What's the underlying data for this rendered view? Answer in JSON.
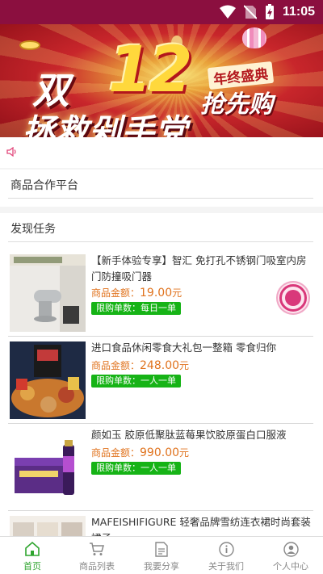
{
  "status_bar": {
    "time": "11:05"
  },
  "banner": {
    "number": "12",
    "shuang": "双",
    "tag": "年终盛典",
    "qiang": "抢先购",
    "main": "拯救剁手党"
  },
  "sections": {
    "platform": "商品合作平台",
    "tasks": "发现任务"
  },
  "products": [
    {
      "title": "【新手体验专享】智汇 免打孔不锈钢门吸室内房门防撞吸门器",
      "price_label": "商品金额：",
      "price": "19.00",
      "unit": "元",
      "limit": "限购单数：每日一单",
      "image": "door-stopper-image"
    },
    {
      "title": "进口食品休闲零食大礼包一整箱 零食归你",
      "price_label": "商品金额：",
      "price": "248.00",
      "unit": "元",
      "limit": "限购单数：一人一单",
      "image": "snack-gift-box-image"
    },
    {
      "title": "颜如玉 胶原低聚肽蓝莓果饮胶原蛋白口服液",
      "price_label": "商品金额：",
      "price": "990.00",
      "unit": "元",
      "limit": "限购单数：一人一单",
      "image": "collagen-drink-image"
    },
    {
      "title": "MAFEISHIFIGURE 轻奢品牌雪纺连衣裙时尚套装裙子",
      "image": "dress-image"
    }
  ],
  "tabs": [
    {
      "label": "首页",
      "icon": "home-icon",
      "active": true
    },
    {
      "label": "商品列表",
      "icon": "cart-icon",
      "active": false
    },
    {
      "label": "我要分享",
      "icon": "share-document-icon",
      "active": false
    },
    {
      "label": "关于我们",
      "icon": "info-icon",
      "active": false
    },
    {
      "label": "个人中心",
      "icon": "user-icon",
      "active": false
    }
  ],
  "colors": {
    "status_bar": "#8b0f3f",
    "price": "#e0731e",
    "limit_badge": "#16b316",
    "active_tab": "#2fa52f",
    "float_button": "#d9387a"
  }
}
